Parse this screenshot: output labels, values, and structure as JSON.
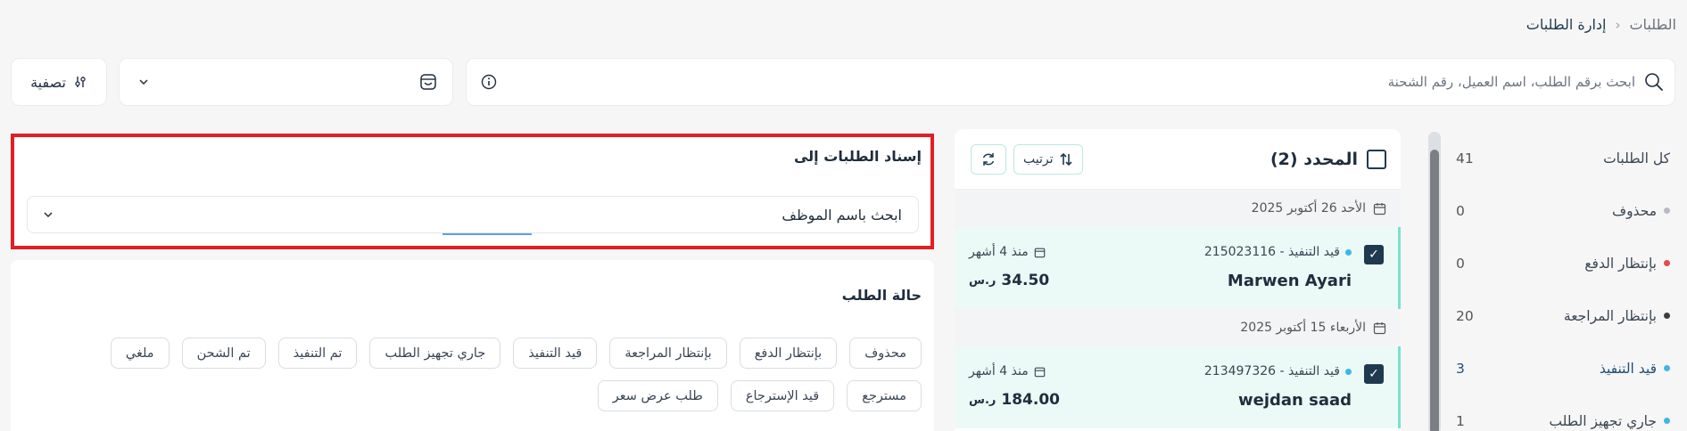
{
  "breadcrumb": {
    "root": "الطلبات",
    "current": "إدارة الطلبات"
  },
  "toolbar": {
    "search_placeholder": "ابحث برقم الطلب، اسم العميل، رقم الشحنة",
    "filter_label": "تصفية",
    "store_select_value": ""
  },
  "sidebar": {
    "items": [
      {
        "label": "كل الطلبات",
        "count": "41",
        "dot": ""
      },
      {
        "label": "محذوف",
        "count": "0",
        "dot": "#b8bcc2"
      },
      {
        "label": "بإنتظار الدفع",
        "count": "0",
        "dot": "#e5484d"
      },
      {
        "label": "بإنتظار المراجعة",
        "count": "20",
        "dot": "#3a3f44"
      },
      {
        "label": "قيد التنفيذ",
        "count": "3",
        "dot": "#3fb6e6"
      },
      {
        "label": "جاري تجهيز الطلب",
        "count": "1",
        "dot": "#3fb6e6"
      }
    ]
  },
  "orders": {
    "selected_label": "المحدد (2)",
    "sort_label": "ترتيب",
    "groups": [
      {
        "date": "الأحد 26 أكتوبر 2025",
        "order": {
          "status": "قيد التنفيذ - 215023116",
          "name": "Marwen Ayari",
          "time": "منذ 4 أشهر",
          "price": "34.50",
          "currency": "ر.س"
        }
      },
      {
        "date": "الأربعاء 15 أكتوبر 2025",
        "order": {
          "status": "قيد التنفيذ - 213497326",
          "name": "wejdan saad",
          "time": "منذ 4 أشهر",
          "price": "184.00",
          "currency": "ر.س"
        }
      }
    ]
  },
  "assign": {
    "title": "إسناد الطلبات إلى",
    "employee_placeholder": "ابحث باسم الموظف"
  },
  "status_filter": {
    "title": "حالة الطلب",
    "chips": [
      "محذوف",
      "بإنتظار الدفع",
      "بإنتظار المراجعة",
      "قيد التنفيذ",
      "جاري تجهيز الطلب",
      "تم التنفيذ",
      "تم الشحن",
      "ملغي",
      "مسترجع",
      "قيد الإسترجاع",
      "طلب عرض سعر"
    ]
  },
  "colors": {
    "accent": "#1f3a4f",
    "highlight": "#e31e24",
    "teal": "#7be0cf"
  }
}
